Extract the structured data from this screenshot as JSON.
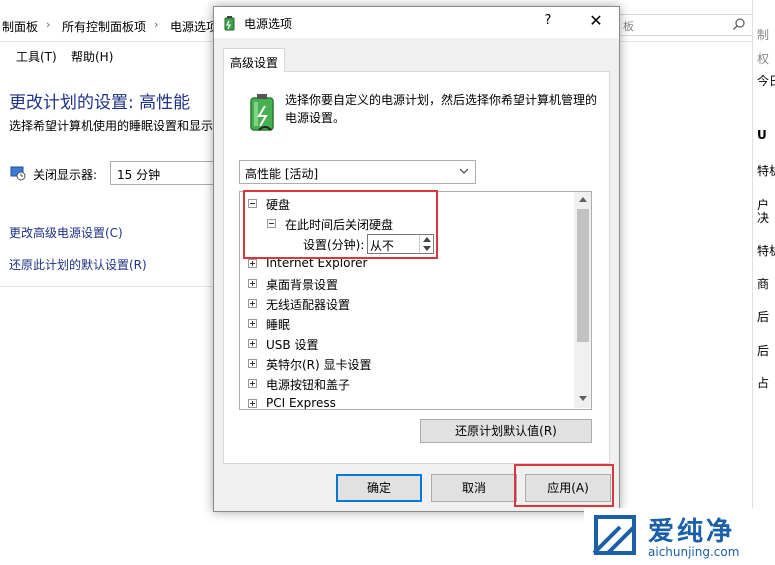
{
  "background_window": {
    "breadcrumbs": [
      "制面板",
      "所有控制面板项",
      "电源选项"
    ],
    "search_placeholder": "板",
    "menu": [
      "工具(T)",
      "帮助(H)"
    ],
    "title": "更改计划的设置: 高性能",
    "subtitle": "选择希望计算机使用的睡眠设置和显示",
    "display_off_label": "关闭显示器:",
    "display_off_value": "15 分钟",
    "links": [
      "更改高级电源设置(C)",
      "还原此计划的默认设置(R)"
    ],
    "right_strip": [
      "制",
      "权",
      "今日",
      "U",
      "特机",
      "户",
      "决",
      "特机",
      "商",
      "后",
      "后",
      "占"
    ]
  },
  "dialog": {
    "title": "电源选项",
    "help": "?",
    "close": "✕",
    "tab": "高级设置",
    "description": "选择你要自定义的电源计划，然后选择你希望计算机管理的电源设置。",
    "plan_selected": "高性能 [活动]",
    "tree": [
      {
        "label": "硬盘",
        "expanded": true,
        "level": 0
      },
      {
        "label": "在此时间后关闭硬盘",
        "expanded": true,
        "level": 1
      },
      {
        "label": "设置(分钟):",
        "value": "从不",
        "level": 2
      },
      {
        "label": "Internet Explorer",
        "expanded": false,
        "level": 0
      },
      {
        "label": "桌面背景设置",
        "expanded": false,
        "level": 0
      },
      {
        "label": "无线适配器设置",
        "expanded": false,
        "level": 0
      },
      {
        "label": "睡眠",
        "expanded": false,
        "level": 0
      },
      {
        "label": "USB 设置",
        "expanded": false,
        "level": 0
      },
      {
        "label": "英特尔(R) 显卡设置",
        "expanded": false,
        "level": 0
      },
      {
        "label": "电源按钮和盖子",
        "expanded": false,
        "level": 0
      },
      {
        "label": "PCI Express",
        "expanded": false,
        "level": 0
      }
    ],
    "restore_button": "还原计划默认值(R)",
    "ok_button": "确定",
    "cancel_button": "取消",
    "apply_button": "应用(A)"
  },
  "watermark": {
    "name": "爱纯净",
    "url": "aichunjing.com"
  },
  "colors": {
    "accent": "#0078d7",
    "link": "#1e3287",
    "highlight_box": "#d9363e",
    "watermark": "#1a5fa8"
  }
}
